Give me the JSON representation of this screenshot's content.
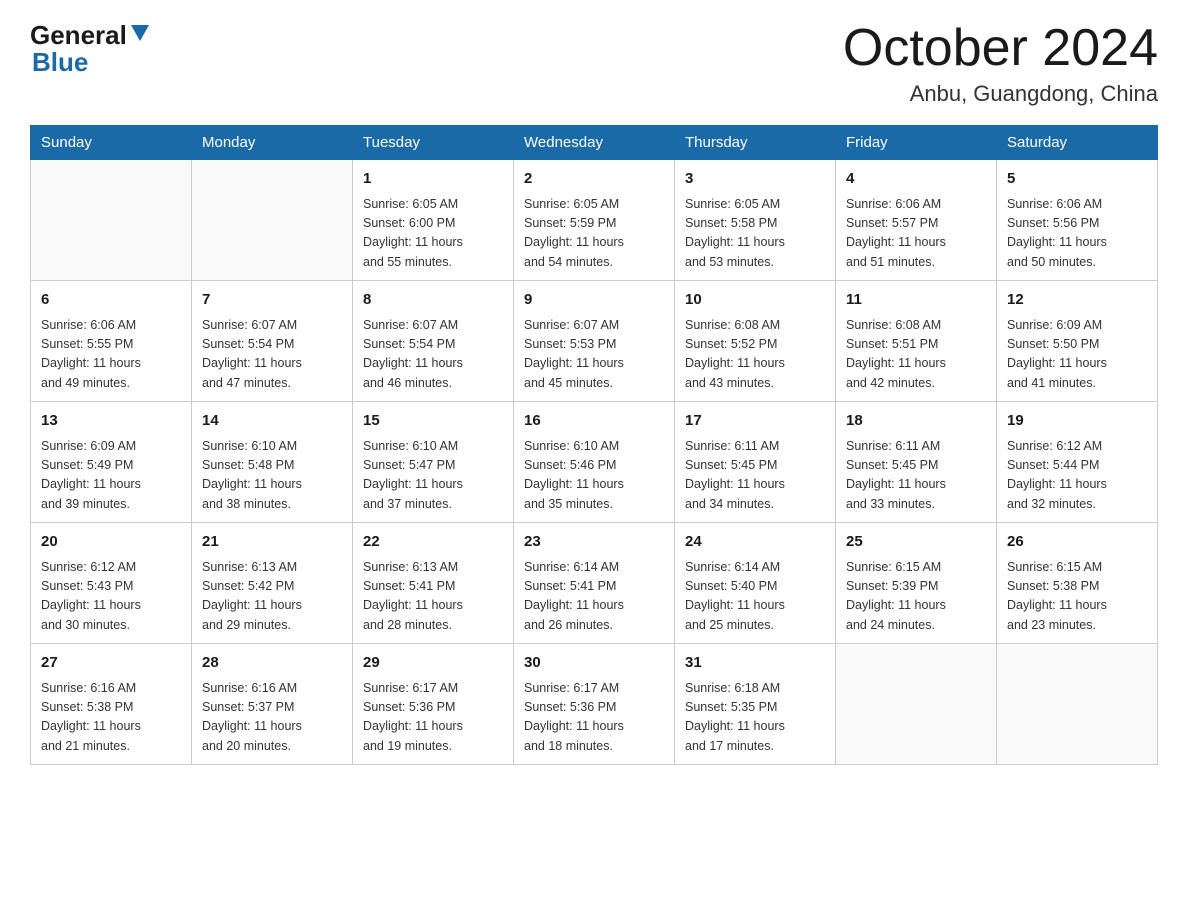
{
  "header": {
    "logo_general": "General",
    "logo_blue": "Blue",
    "title": "October 2024",
    "subtitle": "Anbu, Guangdong, China"
  },
  "calendar": {
    "days_of_week": [
      "Sunday",
      "Monday",
      "Tuesday",
      "Wednesday",
      "Thursday",
      "Friday",
      "Saturday"
    ],
    "weeks": [
      [
        {
          "day": "",
          "info": ""
        },
        {
          "day": "",
          "info": ""
        },
        {
          "day": "1",
          "info": "Sunrise: 6:05 AM\nSunset: 6:00 PM\nDaylight: 11 hours\nand 55 minutes."
        },
        {
          "day": "2",
          "info": "Sunrise: 6:05 AM\nSunset: 5:59 PM\nDaylight: 11 hours\nand 54 minutes."
        },
        {
          "day": "3",
          "info": "Sunrise: 6:05 AM\nSunset: 5:58 PM\nDaylight: 11 hours\nand 53 minutes."
        },
        {
          "day": "4",
          "info": "Sunrise: 6:06 AM\nSunset: 5:57 PM\nDaylight: 11 hours\nand 51 minutes."
        },
        {
          "day": "5",
          "info": "Sunrise: 6:06 AM\nSunset: 5:56 PM\nDaylight: 11 hours\nand 50 minutes."
        }
      ],
      [
        {
          "day": "6",
          "info": "Sunrise: 6:06 AM\nSunset: 5:55 PM\nDaylight: 11 hours\nand 49 minutes."
        },
        {
          "day": "7",
          "info": "Sunrise: 6:07 AM\nSunset: 5:54 PM\nDaylight: 11 hours\nand 47 minutes."
        },
        {
          "day": "8",
          "info": "Sunrise: 6:07 AM\nSunset: 5:54 PM\nDaylight: 11 hours\nand 46 minutes."
        },
        {
          "day": "9",
          "info": "Sunrise: 6:07 AM\nSunset: 5:53 PM\nDaylight: 11 hours\nand 45 minutes."
        },
        {
          "day": "10",
          "info": "Sunrise: 6:08 AM\nSunset: 5:52 PM\nDaylight: 11 hours\nand 43 minutes."
        },
        {
          "day": "11",
          "info": "Sunrise: 6:08 AM\nSunset: 5:51 PM\nDaylight: 11 hours\nand 42 minutes."
        },
        {
          "day": "12",
          "info": "Sunrise: 6:09 AM\nSunset: 5:50 PM\nDaylight: 11 hours\nand 41 minutes."
        }
      ],
      [
        {
          "day": "13",
          "info": "Sunrise: 6:09 AM\nSunset: 5:49 PM\nDaylight: 11 hours\nand 39 minutes."
        },
        {
          "day": "14",
          "info": "Sunrise: 6:10 AM\nSunset: 5:48 PM\nDaylight: 11 hours\nand 38 minutes."
        },
        {
          "day": "15",
          "info": "Sunrise: 6:10 AM\nSunset: 5:47 PM\nDaylight: 11 hours\nand 37 minutes."
        },
        {
          "day": "16",
          "info": "Sunrise: 6:10 AM\nSunset: 5:46 PM\nDaylight: 11 hours\nand 35 minutes."
        },
        {
          "day": "17",
          "info": "Sunrise: 6:11 AM\nSunset: 5:45 PM\nDaylight: 11 hours\nand 34 minutes."
        },
        {
          "day": "18",
          "info": "Sunrise: 6:11 AM\nSunset: 5:45 PM\nDaylight: 11 hours\nand 33 minutes."
        },
        {
          "day": "19",
          "info": "Sunrise: 6:12 AM\nSunset: 5:44 PM\nDaylight: 11 hours\nand 32 minutes."
        }
      ],
      [
        {
          "day": "20",
          "info": "Sunrise: 6:12 AM\nSunset: 5:43 PM\nDaylight: 11 hours\nand 30 minutes."
        },
        {
          "day": "21",
          "info": "Sunrise: 6:13 AM\nSunset: 5:42 PM\nDaylight: 11 hours\nand 29 minutes."
        },
        {
          "day": "22",
          "info": "Sunrise: 6:13 AM\nSunset: 5:41 PM\nDaylight: 11 hours\nand 28 minutes."
        },
        {
          "day": "23",
          "info": "Sunrise: 6:14 AM\nSunset: 5:41 PM\nDaylight: 11 hours\nand 26 minutes."
        },
        {
          "day": "24",
          "info": "Sunrise: 6:14 AM\nSunset: 5:40 PM\nDaylight: 11 hours\nand 25 minutes."
        },
        {
          "day": "25",
          "info": "Sunrise: 6:15 AM\nSunset: 5:39 PM\nDaylight: 11 hours\nand 24 minutes."
        },
        {
          "day": "26",
          "info": "Sunrise: 6:15 AM\nSunset: 5:38 PM\nDaylight: 11 hours\nand 23 minutes."
        }
      ],
      [
        {
          "day": "27",
          "info": "Sunrise: 6:16 AM\nSunset: 5:38 PM\nDaylight: 11 hours\nand 21 minutes."
        },
        {
          "day": "28",
          "info": "Sunrise: 6:16 AM\nSunset: 5:37 PM\nDaylight: 11 hours\nand 20 minutes."
        },
        {
          "day": "29",
          "info": "Sunrise: 6:17 AM\nSunset: 5:36 PM\nDaylight: 11 hours\nand 19 minutes."
        },
        {
          "day": "30",
          "info": "Sunrise: 6:17 AM\nSunset: 5:36 PM\nDaylight: 11 hours\nand 18 minutes."
        },
        {
          "day": "31",
          "info": "Sunrise: 6:18 AM\nSunset: 5:35 PM\nDaylight: 11 hours\nand 17 minutes."
        },
        {
          "day": "",
          "info": ""
        },
        {
          "day": "",
          "info": ""
        }
      ]
    ]
  }
}
